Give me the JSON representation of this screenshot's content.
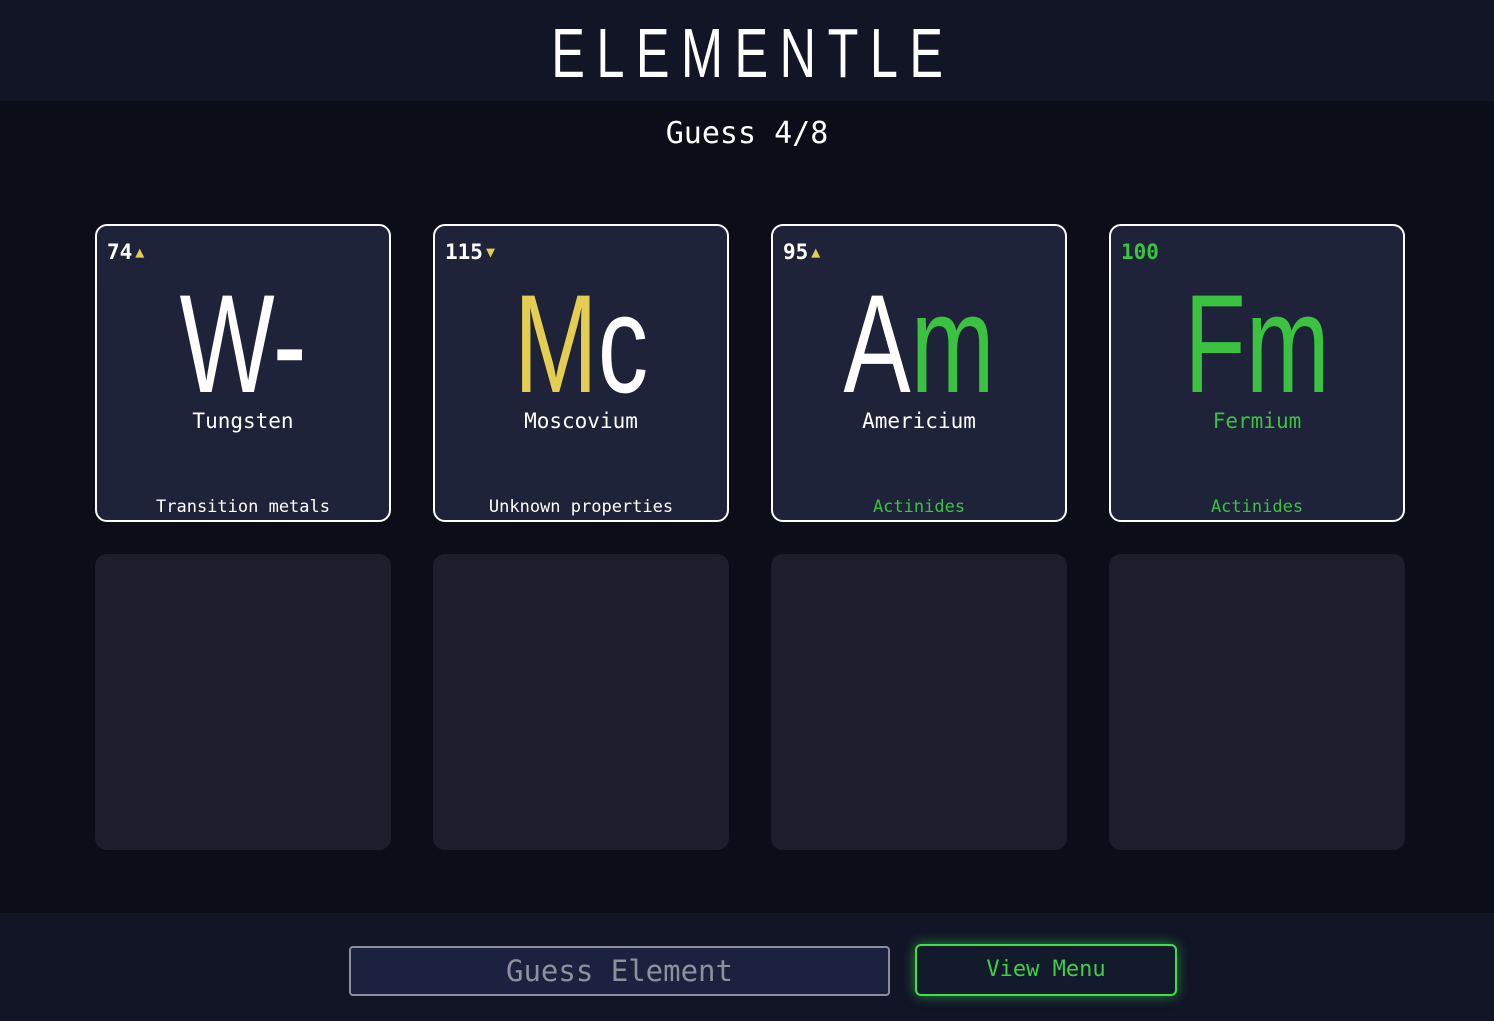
{
  "header": {
    "title": "ELEMENTLE"
  },
  "status": {
    "guess_label": "Guess 4/8"
  },
  "colors": {
    "white": "#ffffff",
    "partial": "#e3cd52",
    "correct": "#3ac240"
  },
  "guesses": [
    {
      "number": "74",
      "number_color": "#ffffff",
      "arrow": "▲",
      "arrow_color": "#e3cd52",
      "symbol_parts": [
        {
          "text": "W-",
          "color": "#ffffff"
        }
      ],
      "name": "Tungsten",
      "name_color": "#ffffff",
      "group": "Transition metals",
      "group_color": "#ffffff"
    },
    {
      "number": "115",
      "number_color": "#ffffff",
      "arrow": "▼",
      "arrow_color": "#e3cd52",
      "symbol_parts": [
        {
          "text": "M",
          "color": "#e3cd52"
        },
        {
          "text": "c",
          "color": "#ffffff"
        }
      ],
      "name": "Moscovium",
      "name_color": "#ffffff",
      "group": "Unknown properties",
      "group_color": "#ffffff"
    },
    {
      "number": "95",
      "number_color": "#ffffff",
      "arrow": "▲",
      "arrow_color": "#e3cd52",
      "symbol_parts": [
        {
          "text": "A",
          "color": "#ffffff"
        },
        {
          "text": "m",
          "color": "#3ac240"
        }
      ],
      "name": "Americium",
      "name_color": "#ffffff",
      "group": "Actinides",
      "group_color": "#3ac240"
    },
    {
      "number": "100",
      "number_color": "#3ac240",
      "arrow": "",
      "arrow_color": "#3ac240",
      "symbol_parts": [
        {
          "text": "Fm",
          "color": "#3ac240"
        }
      ],
      "name": "Fermium",
      "name_color": "#3ac240",
      "group": "Actinides",
      "group_color": "#3ac240"
    }
  ],
  "empty_slots": 4,
  "footer": {
    "guess_button_label": "Guess Element",
    "menu_button_label": "View Menu"
  }
}
